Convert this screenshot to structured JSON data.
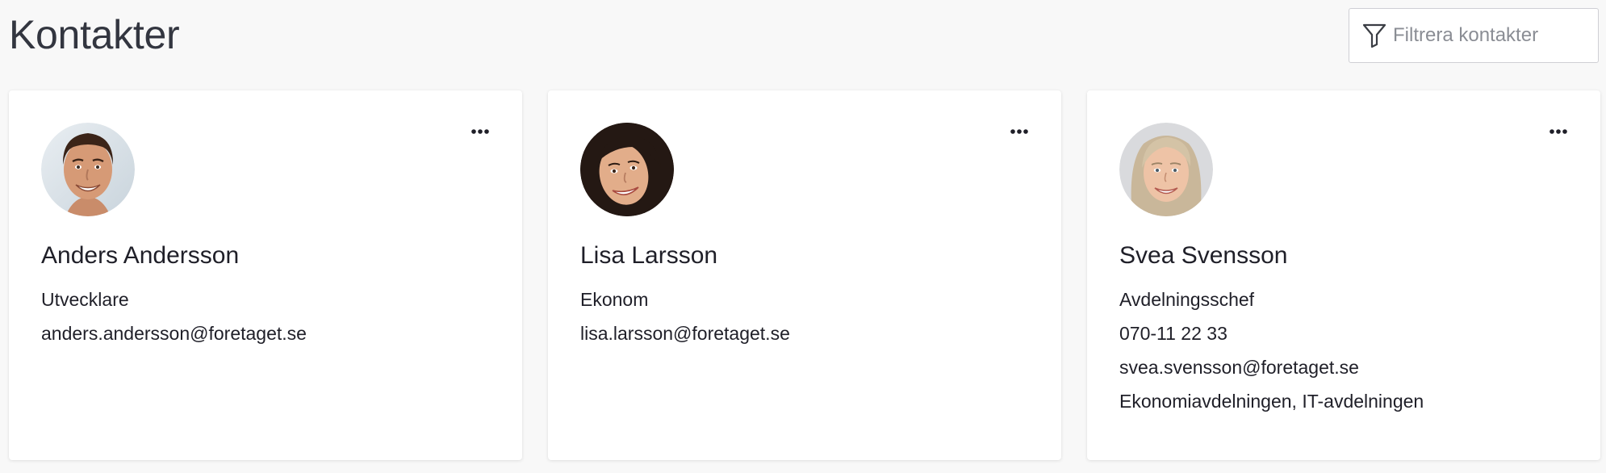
{
  "header": {
    "title": "Kontakter",
    "filter": {
      "placeholder": "Filtrera kontakter",
      "value": "",
      "icon": "funnel-icon"
    }
  },
  "contacts": [
    {
      "name": "Anders Andersson",
      "details": [
        "Utvecklare",
        "anders.andersson@foretaget.se"
      ],
      "avatar": "male-smiling-portrait",
      "menu_icon": "more-horizontal-icon"
    },
    {
      "name": "Lisa Larsson",
      "details": [
        "Ekonom",
        "lisa.larsson@foretaget.se"
      ],
      "avatar": "female-dark-hair-portrait",
      "menu_icon": "more-horizontal-icon"
    },
    {
      "name": "Svea Svensson",
      "details": [
        "Avdelningsschef",
        "070-11 22 33",
        "svea.svensson@foretaget.se",
        "Ekonomiavdelningen, IT-avdelningen"
      ],
      "avatar": "female-blonde-portrait",
      "menu_icon": "more-horizontal-icon"
    }
  ],
  "colors": {
    "background": "#f8f8f8",
    "card": "#ffffff",
    "text": "#1f1f28",
    "title": "#333640",
    "placeholder": "#8a8d94"
  }
}
